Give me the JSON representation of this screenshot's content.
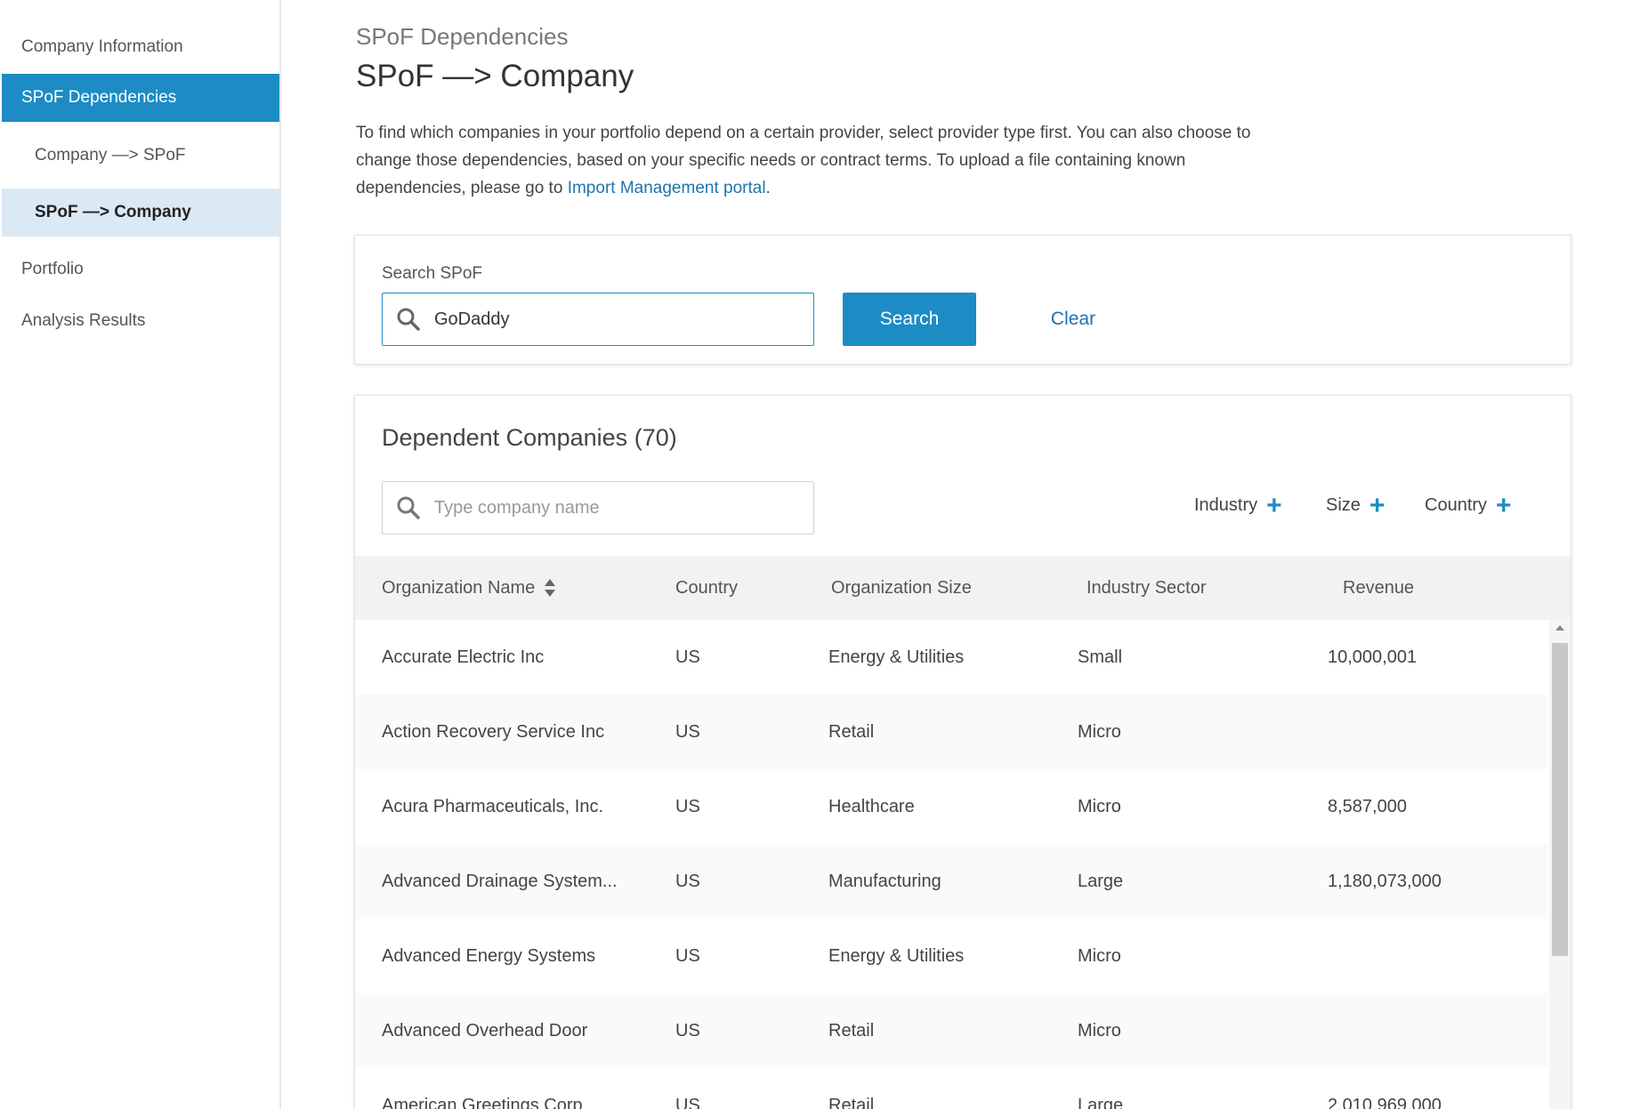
{
  "sidebar": {
    "items": [
      {
        "label": "Company Information"
      },
      {
        "label": "SPoF Dependencies"
      },
      {
        "label": "Company —> SPoF"
      },
      {
        "label": "SPoF —> Company"
      },
      {
        "label": "Portfolio"
      },
      {
        "label": "Analysis Results"
      }
    ]
  },
  "header": {
    "breadcrumb": "SPoF Dependencies",
    "title": "SPoF —> Company",
    "description": "To find which companies in your portfolio depend on a certain provider, select provider type first. You can also choose to change those dependencies, based on your specific needs or contract terms. To upload a file containing known dependencies, please go to",
    "link_text": "Import Management portal",
    "link_suffix": "."
  },
  "search": {
    "label": "Search SPoF",
    "value": "GoDaddy",
    "search_button": "Search",
    "clear_button": "Clear"
  },
  "results": {
    "title": "Dependent Companies",
    "count": "(70)",
    "filter_placeholder": "Type company name",
    "facets": [
      "Industry",
      "Size",
      "Country"
    ],
    "columns": [
      "Organization Name",
      "Country",
      "Organization Size",
      "Industry Sector",
      "Revenue"
    ],
    "rows": [
      {
        "name": "Accurate Electric Inc",
        "country": "US",
        "col3": "Energy & Utilities",
        "col4": "Small",
        "revenue": "10,000,001"
      },
      {
        "name": "Action Recovery Service Inc",
        "country": "US",
        "col3": "Retail",
        "col4": "Micro",
        "revenue": ""
      },
      {
        "name": "Acura Pharmaceuticals, Inc.",
        "country": "US",
        "col3": "Healthcare",
        "col4": "Micro",
        "revenue": "8,587,000"
      },
      {
        "name": "Advanced Drainage System...",
        "country": "US",
        "col3": "Manufacturing",
        "col4": "Large",
        "revenue": "1,180,073,000"
      },
      {
        "name": "Advanced Energy Systems",
        "country": "US",
        "col3": "Energy & Utilities",
        "col4": "Micro",
        "revenue": ""
      },
      {
        "name": "Advanced Overhead Door",
        "country": "US",
        "col3": "Retail",
        "col4": "Micro",
        "revenue": ""
      },
      {
        "name": "American Greetings Corp",
        "country": "US",
        "col3": "Retail",
        "col4": "Large",
        "revenue": "2,010,969,000"
      }
    ]
  },
  "colors": {
    "accent": "#1d8cc4",
    "link": "#1d75ad",
    "active_sub_bg": "#dbe9f4"
  }
}
